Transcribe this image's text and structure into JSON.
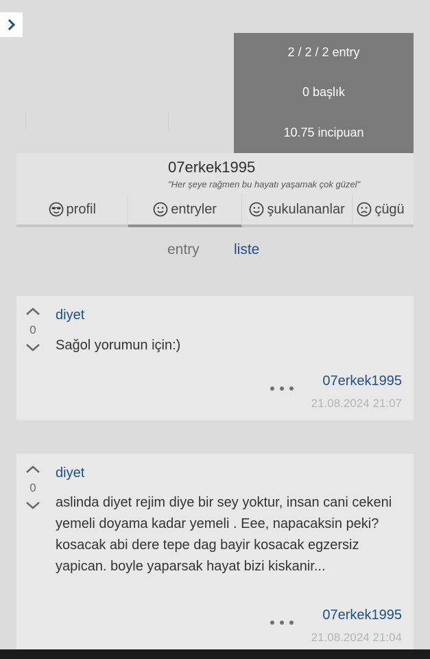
{
  "stats": {
    "entries": "2 / 2 / 2 entry",
    "topics": "0 başlık",
    "points": "10.75 incipuan"
  },
  "profile": {
    "username": "07erkek1995",
    "quote": "\"Her şeye rağmen bu hayatı yaşamak çok güzel\""
  },
  "tabs": [
    {
      "label": "profil",
      "icon": "sunglasses-face-icon"
    },
    {
      "label": "entryler",
      "icon": "smiley-icon"
    },
    {
      "label": "şukulananlar",
      "icon": "smiley-icon"
    },
    {
      "label": "çügü",
      "icon": "frown-icon"
    }
  ],
  "subnav": {
    "entry": "entry",
    "liste": "liste"
  },
  "entries": [
    {
      "topic": "diyet",
      "votes": "0",
      "content": "Sağol yorumun için:)",
      "author": "07erkek1995",
      "date": "21.08.2024 21:07"
    },
    {
      "topic": "diyet",
      "votes": "0",
      "content": "aslinda diyet rejim diye bir sey yoktur, insan cani cekeni yemeli doyama kadar yemeli . Eee, napacaksin peki? kosacak abi dere tepe dag bayir kosacak egzersiz yapican. boyle yaparsak hayat bizi kiskanir...",
      "author": "07erkek1995",
      "date": "21.08.2024 21:04"
    }
  ],
  "colors": {
    "link": "#1e4f85",
    "stats_bg": "#7a7a7a",
    "page_bg": "#dcdcdc"
  }
}
